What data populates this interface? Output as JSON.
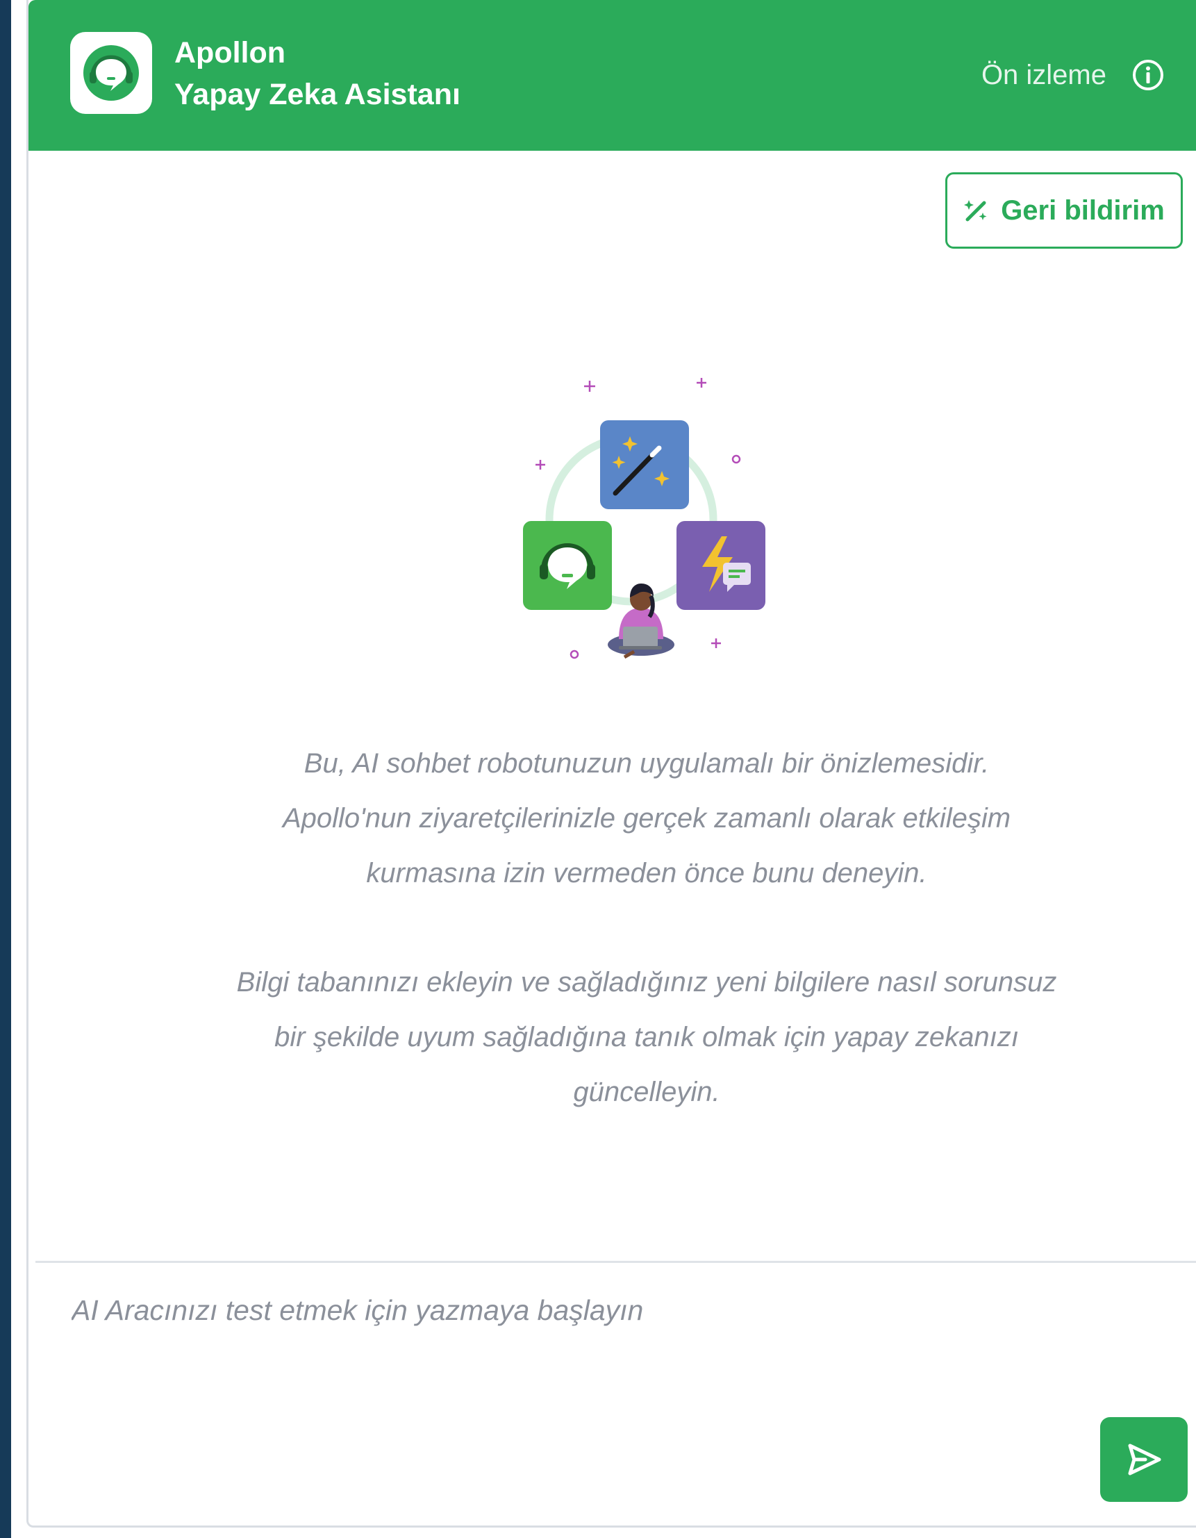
{
  "header": {
    "title": "Apollon",
    "subtitle": "Yapay Zeka Asistanı",
    "preview_label": "Ön izleme",
    "logo_icon": "headset-chat-icon",
    "info_icon": "info-icon"
  },
  "feedback": {
    "label": "Geri bildirim",
    "icon": "magic-wand-icon"
  },
  "illustration": {
    "icons": [
      "magic-wand-tile-icon",
      "headset-chat-tile-icon",
      "lightning-chat-tile-icon",
      "person-laptop-icon"
    ]
  },
  "description": {
    "paragraph1_lines": [
      "Bu, AI sohbet robotunuzun uygulamalı bir önizlemesidir.",
      "Apollo'nun ziyaretçilerinizle gerçek zamanlı olarak etkileşim",
      "kurmasına izin vermeden önce bunu deneyin."
    ],
    "paragraph2_lines": [
      "Bilgi tabanınızı ekleyin ve sağladığınız yeni bilgilere nasıl sorunsuz",
      "bir şekilde uyum sağladığına tanık olmak için yapay zekanızı",
      "güncelleyin."
    ]
  },
  "chat": {
    "placeholder": "AI Aracınızı test etmek için yazmaya başlayın",
    "value": "",
    "send_icon": "send-icon"
  },
  "colors": {
    "brand_green": "#2bab5a",
    "text_muted": "#8b909a",
    "sidebar_dark": "#163a58",
    "tile_blue": "#5a86c8",
    "tile_purple": "#7a5fb0",
    "tile_green": "#4bb84e"
  }
}
